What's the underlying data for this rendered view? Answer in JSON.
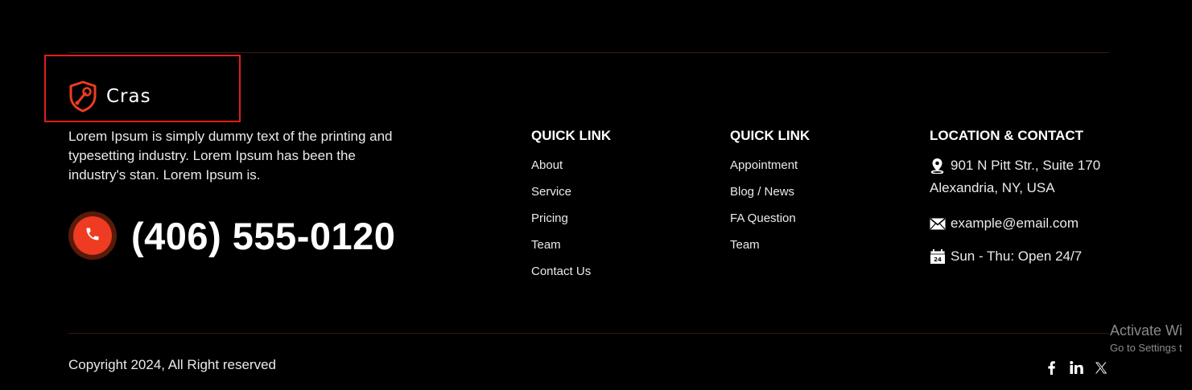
{
  "brand": {
    "name": "Cras",
    "accent_color": "#ee3b22",
    "highlight_color": "#e11d1d"
  },
  "about": {
    "text": "Lorem Ipsum is simply dummy text of the printing and typesetting industry. Lorem Ipsum has been the industry's stan. Lorem Ipsum is."
  },
  "phone": {
    "icon": "phone-icon",
    "number": "(406) 555-0120"
  },
  "quick_links_1": {
    "title": "QUICK LINK",
    "items": [
      "About",
      "Service",
      "Pricing",
      "Team",
      "Contact Us"
    ]
  },
  "quick_links_2": {
    "title": "QUICK LINK",
    "items": [
      "Appointment",
      "Blog / News",
      "FA Question",
      "Team"
    ]
  },
  "contact": {
    "title": "LOCATION & CONTACT",
    "address_line1": "901 N Pitt Str., Suite 170",
    "address_line2": "Alexandria, NY, USA",
    "email": "example@email.com",
    "hours": "Sun - Thu: Open 24/7",
    "address_icon": "map-pin-icon",
    "email_icon": "envelope-icon",
    "hours_icon": "calendar-icon"
  },
  "footer": {
    "copyright": "Copyright 2024, All Right reserved",
    "socials": [
      "facebook-icon",
      "linkedin-icon",
      "x-icon"
    ]
  },
  "os_overlay": {
    "line1": "Activate Wi",
    "line2": "Go to Settings t"
  }
}
